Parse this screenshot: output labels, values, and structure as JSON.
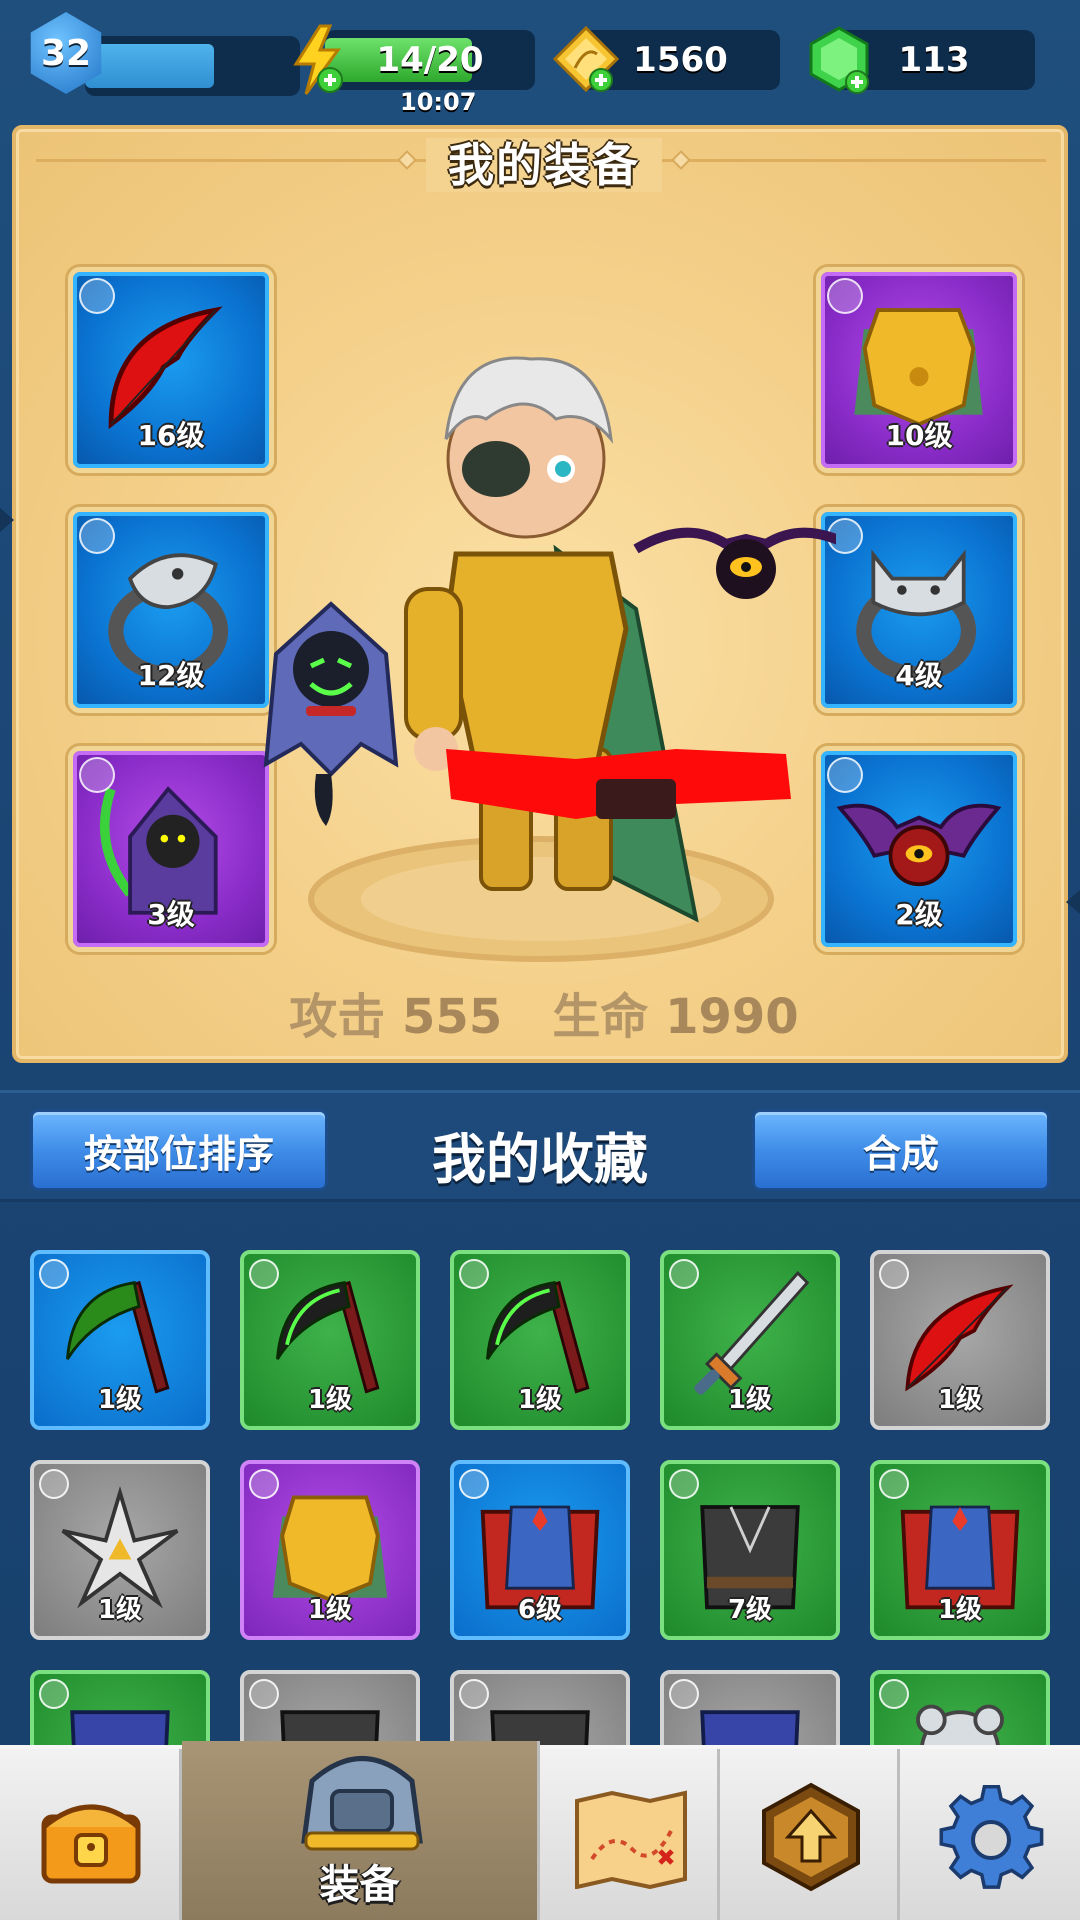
{
  "topbar": {
    "level": "32",
    "level_progress": 0.6,
    "energy": "14/20",
    "energy_progress": 0.7,
    "energy_timer": "10:07",
    "coins": "1560",
    "gems": "113"
  },
  "equip": {
    "title": "我的装备",
    "slots": [
      {
        "item": "red-bow",
        "type": "weapon",
        "level": "16级",
        "rarity": "blue"
      },
      {
        "item": "eagle-ring",
        "type": "ring",
        "level": "12级",
        "rarity": "blue"
      },
      {
        "item": "reaper-pet",
        "type": "pet",
        "level": "3级",
        "rarity": "purple"
      },
      {
        "item": "gold-armor",
        "type": "armor",
        "level": "10级",
        "rarity": "purple"
      },
      {
        "item": "wolf-ring",
        "type": "ring",
        "level": "4级",
        "rarity": "blue"
      },
      {
        "item": "bat-pet",
        "type": "pet",
        "level": "2级",
        "rarity": "blue"
      }
    ],
    "stats": {
      "attack_label": "攻击",
      "attack": "555",
      "hp_label": "生命",
      "hp": "1990"
    }
  },
  "collection": {
    "sort_button": "按部位排序",
    "title": "我的收藏",
    "merge_button": "合成",
    "items": [
      {
        "item": "scythe",
        "level": "1级",
        "rarity": "blue"
      },
      {
        "item": "scythe",
        "level": "1级",
        "rarity": "green"
      },
      {
        "item": "scythe",
        "level": "1级",
        "rarity": "green"
      },
      {
        "item": "serrated-sword",
        "level": "1级",
        "rarity": "green"
      },
      {
        "item": "red-bow",
        "level": "1级",
        "rarity": "gray"
      },
      {
        "item": "shuriken",
        "level": "1级",
        "rarity": "gray"
      },
      {
        "item": "gold-armor",
        "level": "1级",
        "rarity": "purple"
      },
      {
        "item": "red-cape-armor",
        "level": "6级",
        "rarity": "blue"
      },
      {
        "item": "dark-robe",
        "level": "7级",
        "rarity": "green"
      },
      {
        "item": "red-cape-armor",
        "level": "1级",
        "rarity": "green"
      }
    ]
  },
  "nav": {
    "items": [
      {
        "name": "shop",
        "label": ""
      },
      {
        "name": "equipment",
        "label": "装备"
      },
      {
        "name": "map",
        "label": ""
      },
      {
        "name": "upgrade",
        "label": ""
      },
      {
        "name": "settings",
        "label": ""
      }
    ]
  },
  "colors": {
    "background": "#1b4574",
    "panel": "#f4d08a",
    "blue_rarity": "#0a72d0",
    "purple_rarity": "#8a2cc9",
    "green_rarity": "#1e8a2b",
    "gray_rarity": "#7d7d7d",
    "button": "#3f8de8"
  }
}
